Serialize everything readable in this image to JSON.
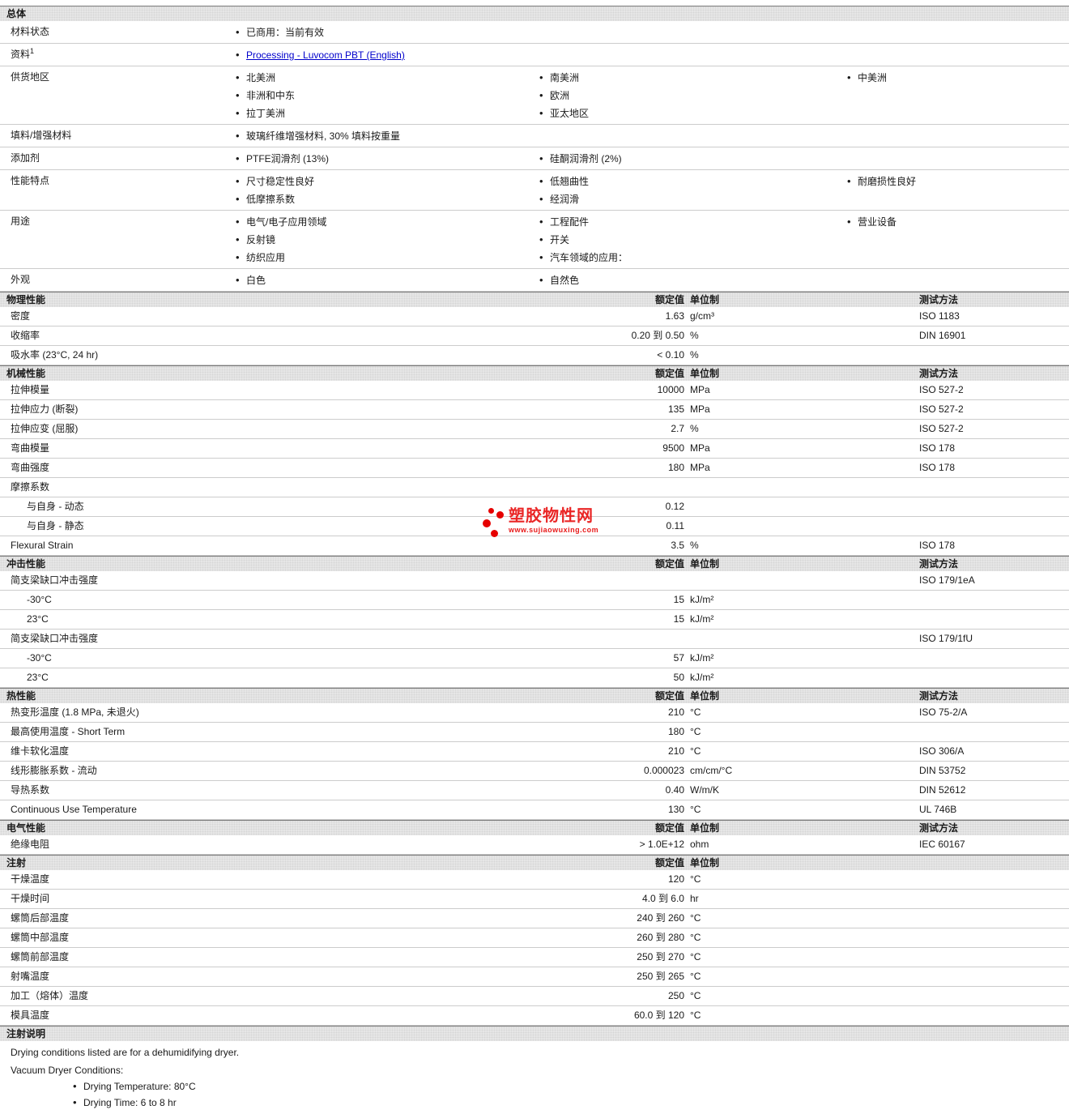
{
  "watermark": {
    "title": "塑胶物性网",
    "url": "www.sujiaowuxing.com",
    "color": "#e60000"
  },
  "link_color": "#0000cc",
  "sections": [
    {
      "type": "bullets",
      "title": "总体",
      "rows": [
        {
          "label": "材料状态",
          "cols": [
            [
              "已商用：当前有效"
            ],
            [],
            []
          ]
        },
        {
          "label": "资料",
          "sup": "1",
          "link": true,
          "cols": [
            [
              "Processing - Luvocom PBT (English)"
            ],
            [],
            []
          ]
        },
        {
          "label": "供货地区",
          "cols": [
            [
              "北美洲",
              "非洲和中东",
              "拉丁美洲"
            ],
            [
              "南美洲",
              "欧洲",
              "亚太地区"
            ],
            [
              "中美洲"
            ]
          ]
        },
        {
          "label": "填料/增强材料",
          "cols": [
            [
              "玻璃纤维增强材料, 30% 填料按重量"
            ],
            [],
            []
          ]
        },
        {
          "label": "添加剂",
          "cols": [
            [
              "PTFE润滑剂  (13%)"
            ],
            [
              "硅酮润滑剂  (2%)"
            ],
            []
          ]
        },
        {
          "label": "性能特点",
          "cols": [
            [
              "尺寸稳定性良好",
              "低摩擦系数"
            ],
            [
              "低翘曲性",
              "经润滑"
            ],
            [
              "耐磨损性良好"
            ]
          ]
        },
        {
          "label": "用途",
          "cols": [
            [
              "电气/电子应用领域",
              "反射镜",
              "纺织应用"
            ],
            [
              "工程配件",
              "开关",
              "汽车领域的应用："
            ],
            [
              "营业设备"
            ]
          ]
        },
        {
          "label": "外观",
          "cols": [
            [
              "白色"
            ],
            [
              "自然色"
            ],
            []
          ]
        }
      ]
    },
    {
      "type": "props",
      "title": "物理性能",
      "col_headers": {
        "value": "额定值",
        "unit": "单位制",
        "method": "测试方法"
      },
      "rows": [
        {
          "label": "密度",
          "value": "1.63",
          "unit": "g/cm³",
          "method": "ISO 1183"
        },
        {
          "label": "收缩率",
          "value": "0.20 到  0.50",
          "unit": "%",
          "method": "DIN 16901"
        },
        {
          "label": "吸水率  (23°C, 24 hr)",
          "value": "< 0.10",
          "unit": "%",
          "method": ""
        }
      ]
    },
    {
      "type": "props",
      "title": "机械性能",
      "col_headers": {
        "value": "额定值",
        "unit": "单位制",
        "method": "测试方法"
      },
      "rows": [
        {
          "label": "拉伸模量",
          "value": "10000",
          "unit": "MPa",
          "method": "ISO 527-2"
        },
        {
          "label": "拉伸应力  (断裂)",
          "value": "135",
          "unit": "MPa",
          "method": "ISO 527-2"
        },
        {
          "label": "拉伸应变  (屈服)",
          "value": "2.7",
          "unit": "%",
          "method": "ISO 527-2"
        },
        {
          "label": "弯曲模量",
          "value": "9500",
          "unit": "MPa",
          "method": "ISO 178"
        },
        {
          "label": "弯曲强度",
          "value": "180",
          "unit": "MPa",
          "method": "ISO 178"
        },
        {
          "label": "摩擦系数",
          "value": "",
          "unit": "",
          "method": ""
        },
        {
          "label": "与自身  - 动态",
          "indent": true,
          "value": "0.12",
          "unit": "",
          "method": ""
        },
        {
          "label": "与自身  - 静态",
          "indent": true,
          "value": "0.11",
          "unit": "",
          "method": ""
        },
        {
          "label": "Flexural Strain",
          "value": "3.5",
          "unit": "%",
          "method": "ISO 178"
        }
      ]
    },
    {
      "type": "props",
      "title": "冲击性能",
      "col_headers": {
        "value": "额定值",
        "unit": "单位制",
        "method": "测试方法"
      },
      "rows": [
        {
          "label": "简支梁缺口冲击强度",
          "value": "",
          "unit": "",
          "method": "ISO 179/1eA"
        },
        {
          "label": "-30°C",
          "indent": true,
          "value": "15",
          "unit": "kJ/m²",
          "method": ""
        },
        {
          "label": "23°C",
          "indent": true,
          "value": "15",
          "unit": "kJ/m²",
          "method": ""
        },
        {
          "label": "简支梁缺口冲击强度",
          "value": "",
          "unit": "",
          "method": "ISO 179/1fU"
        },
        {
          "label": "-30°C",
          "indent": true,
          "value": "57",
          "unit": "kJ/m²",
          "method": ""
        },
        {
          "label": "23°C",
          "indent": true,
          "value": "50",
          "unit": "kJ/m²",
          "method": ""
        }
      ]
    },
    {
      "type": "props",
      "title": "热性能",
      "col_headers": {
        "value": "额定值",
        "unit": "单位制",
        "method": "测试方法"
      },
      "rows": [
        {
          "label": "热变形温度  (1.8 MPa, 未退火)",
          "value": "210",
          "unit": "°C",
          "method": "ISO 75-2/A"
        },
        {
          "label": "最高使用温度  - Short Term",
          "value": "180",
          "unit": "°C",
          "method": ""
        },
        {
          "label": "维卡软化温度",
          "value": "210",
          "unit": "°C",
          "method": "ISO 306/A"
        },
        {
          "label": "线形膨胀系数  - 流动",
          "value": "0.000023",
          "unit": "cm/cm/°C",
          "method": "DIN 53752"
        },
        {
          "label": "导热系数",
          "value": "0.40",
          "unit": "W/m/K",
          "method": "DIN 52612"
        },
        {
          "label": "Continuous Use Temperature",
          "value": "130",
          "unit": "°C",
          "method": "UL 746B"
        }
      ]
    },
    {
      "type": "props",
      "title": "电气性能",
      "col_headers": {
        "value": "额定值",
        "unit": "单位制",
        "method": "测试方法"
      },
      "rows": [
        {
          "label": "绝缘电阻",
          "value": "> 1.0E+12",
          "unit": "ohm",
          "method": "IEC 60167"
        }
      ]
    },
    {
      "type": "props",
      "title": "注射",
      "col_headers": {
        "value": "额定值",
        "unit": "单位制"
      },
      "rows": [
        {
          "label": "干燥温度",
          "value": "120",
          "unit": "°C"
        },
        {
          "label": "干燥时间",
          "value": "4.0 到  6.0",
          "unit": "hr"
        },
        {
          "label": "螺筒后部温度",
          "value": "240 到  260",
          "unit": "°C"
        },
        {
          "label": "螺筒中部温度",
          "value": "260 到  280",
          "unit": "°C"
        },
        {
          "label": "螺筒前部温度",
          "value": "250 到  270",
          "unit": "°C"
        },
        {
          "label": "射嘴温度",
          "value": "250 到  265",
          "unit": "°C"
        },
        {
          "label": "加工（熔体）温度",
          "value": "250",
          "unit": "°C"
        },
        {
          "label": "模具温度",
          "value": "60.0 到  120",
          "unit": "°C"
        }
      ]
    },
    {
      "type": "notes",
      "title": "注射说明",
      "lines": [
        "Drying conditions listed are for a dehumidifying dryer.",
        "Vacuum Dryer Conditions:"
      ],
      "bullets": [
        "Drying Temperature: 80°C",
        "Drying Time: 6 to 8 hr"
      ]
    }
  ]
}
